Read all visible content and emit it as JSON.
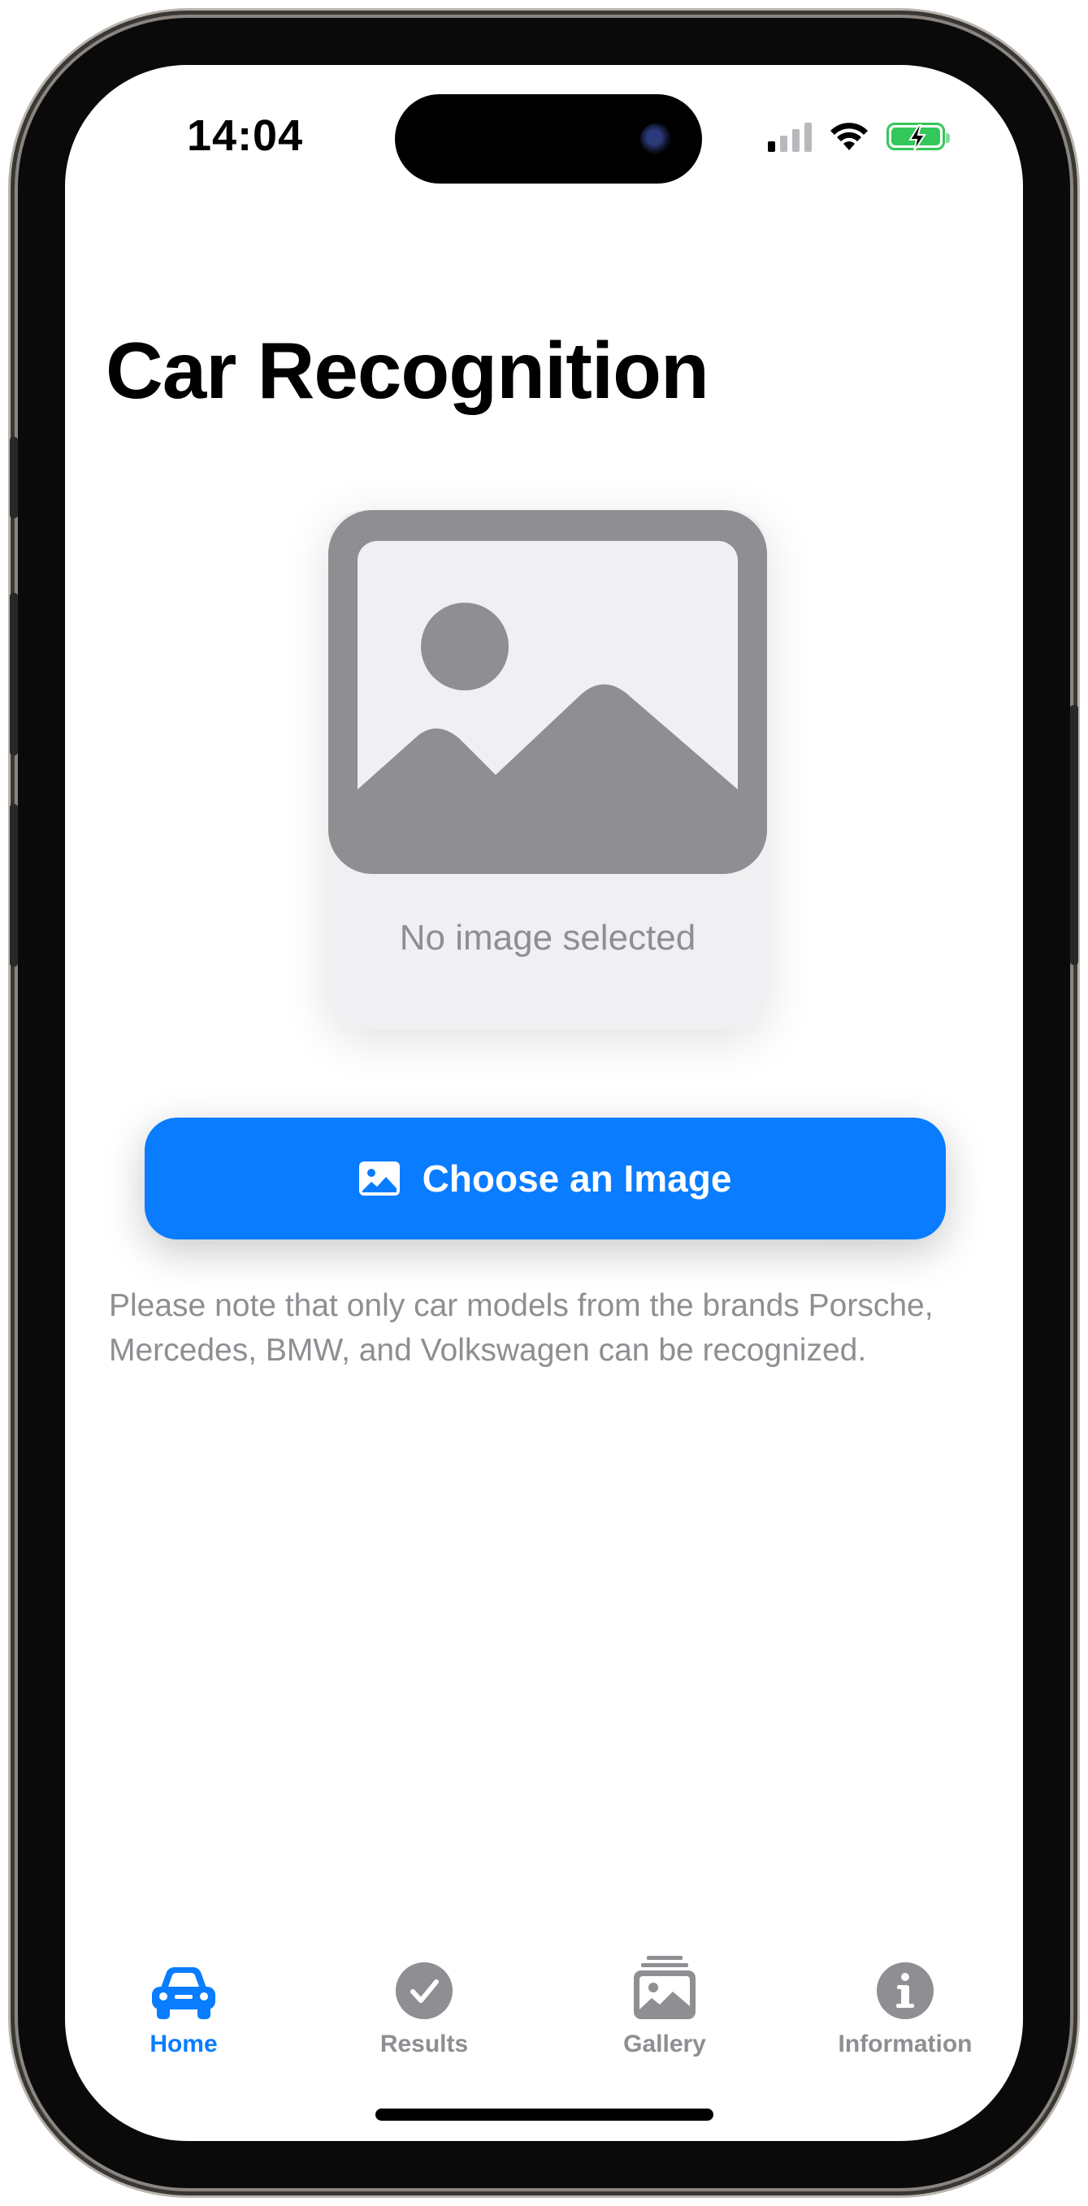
{
  "status_bar": {
    "time": "14:04",
    "signal_bars_active": 1,
    "icons": [
      "cellular-signal-icon",
      "wifi-icon",
      "battery-charging-icon"
    ],
    "battery_color": "#34c759"
  },
  "page": {
    "title": "Car Recognition"
  },
  "image_placeholder": {
    "icon": "photo-icon",
    "label": "No image selected"
  },
  "choose_button": {
    "icon": "photo-icon",
    "label": "Choose an Image"
  },
  "note": "Please note that only car models from the brands Porsche, Mercedes, BMW, and Volkswagen can be recognized.",
  "tab_bar": {
    "items": [
      {
        "icon": "car-icon",
        "label": "Home",
        "selected": true
      },
      {
        "icon": "checkmark-circle-icon",
        "label": "Results",
        "selected": false
      },
      {
        "icon": "photo-stack-icon",
        "label": "Gallery",
        "selected": false
      },
      {
        "icon": "info-circle-icon",
        "label": "Information",
        "selected": false
      }
    ]
  },
  "colors": {
    "accent": "#0a7cff",
    "secondary_text": "#8e8e93",
    "placeholder_icon": "#8e8e93"
  }
}
